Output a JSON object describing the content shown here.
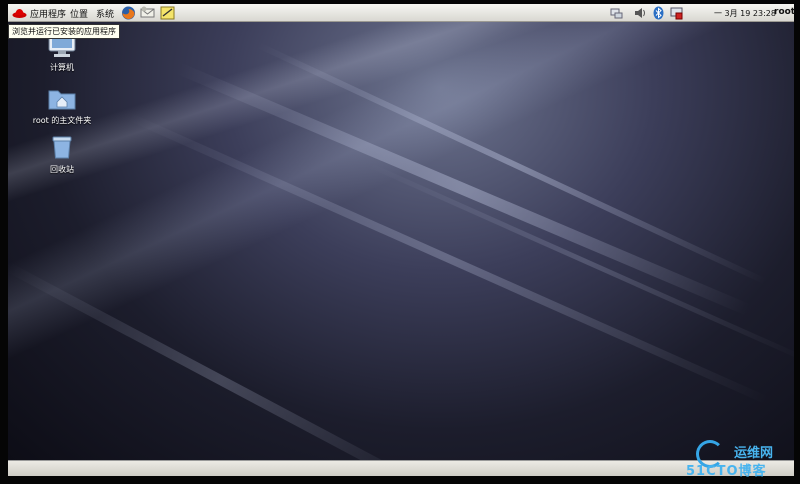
{
  "topbar": {
    "menus": [
      "应用程序",
      "位置",
      "系统"
    ],
    "launchers": [
      "redhat-icon",
      "firefox-icon",
      "email-icon",
      "notes-icon"
    ],
    "clock": "一 3月 19 23:28",
    "user": "root",
    "tray_icons": [
      "network-icon",
      "volume-icon",
      "bluetooth-icon",
      "update-icon"
    ]
  },
  "tooltip": "浏览并运行已安装的应用程序",
  "desktop_icons": [
    {
      "label": "计算机",
      "icon": "computer-icon"
    },
    {
      "label": "root 的主文件夹",
      "icon": "home-folder-icon"
    },
    {
      "label": "回收站",
      "icon": "trash-icon"
    }
  ],
  "watermark": {
    "title": "运维网",
    "subtitle": "51CTO博客"
  }
}
